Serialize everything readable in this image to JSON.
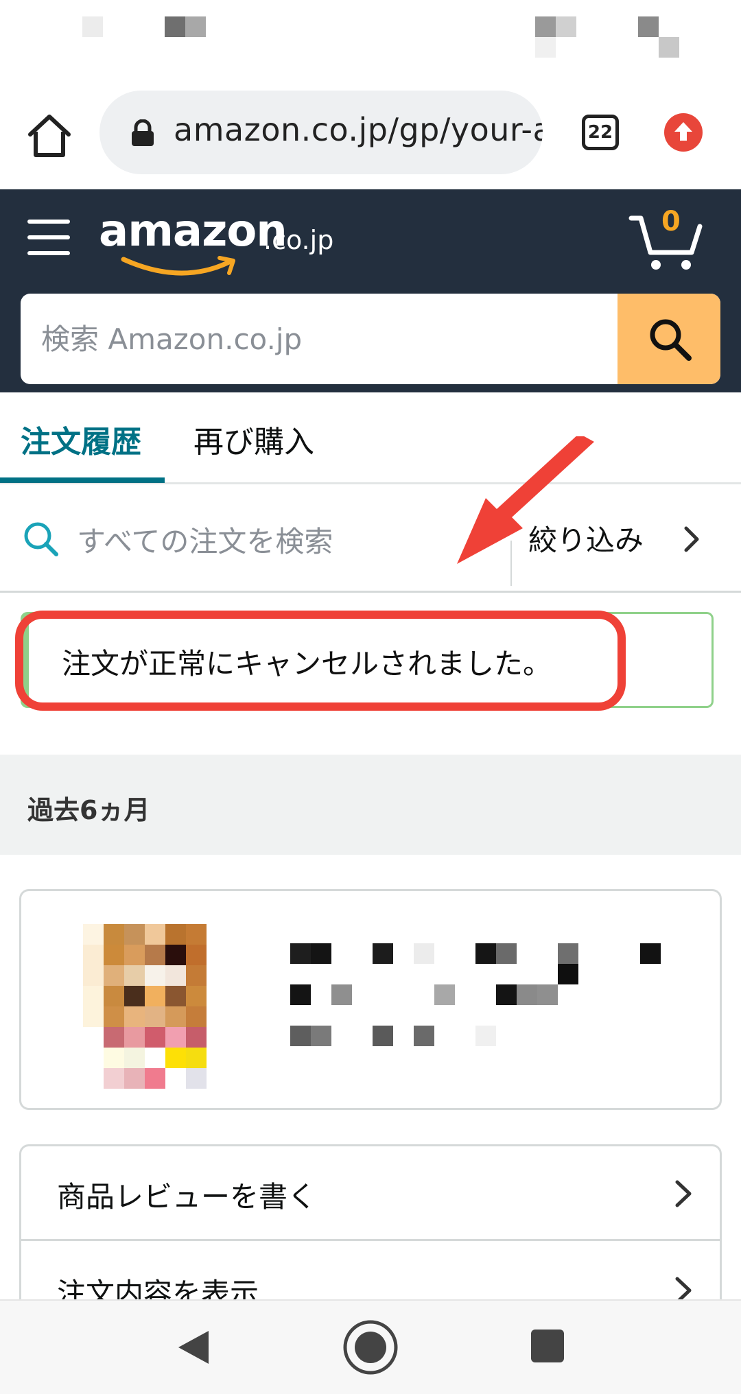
{
  "browser": {
    "url": "amazon.co.jp/gp/your-a",
    "tab_count": "22",
    "icons": {
      "home": "home-icon",
      "lock": "lock-icon",
      "update": "update-arrow-icon"
    }
  },
  "header": {
    "logo_main": "amazon",
    "logo_suffix": ".co.jp",
    "cart_count": "0",
    "search_placeholder": "検索 Amazon.co.jp",
    "colors": {
      "header_bg": "#232f3e",
      "search_button": "#febd69",
      "logo_smile": "#f6a623"
    }
  },
  "tabs": [
    {
      "label": "注文履歴",
      "active": true
    },
    {
      "label": "再び購入",
      "active": false
    }
  ],
  "order_search": {
    "placeholder": "すべての注文を検索",
    "filter_label": "絞り込み"
  },
  "alert": {
    "message": "注文が正常にキャンセルされました。"
  },
  "period": {
    "label": "過去6ヵ月"
  },
  "actions": [
    {
      "label": "商品レビューを書く"
    },
    {
      "label": "注文内容を表示"
    }
  ],
  "accent_color": "#007185",
  "annotation_color": "#ef4137"
}
